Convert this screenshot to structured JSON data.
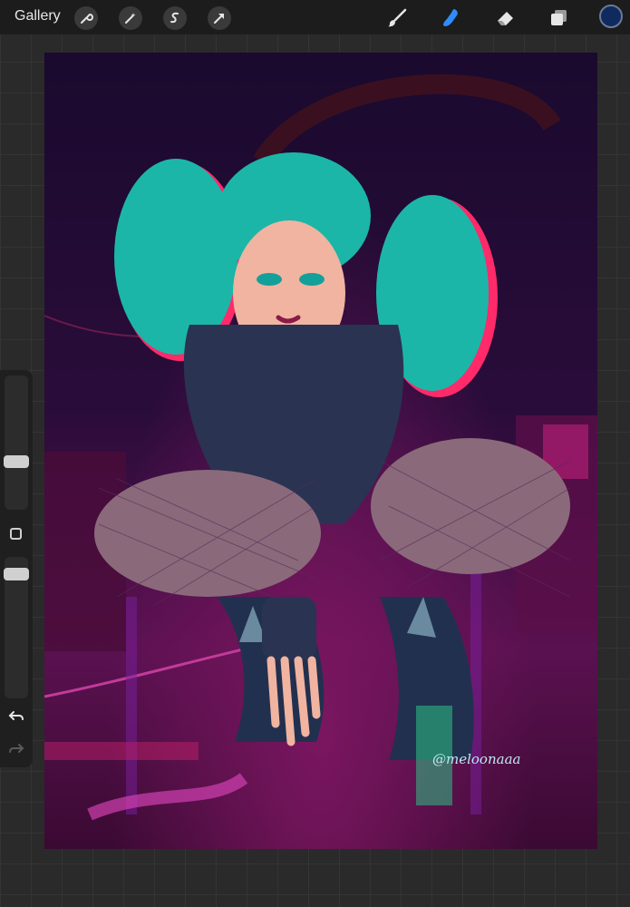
{
  "topbar": {
    "gallery_label": "Gallery",
    "left_tools": [
      "wrench-icon",
      "magic-wand-icon",
      "selection-icon",
      "transform-arrow-icon"
    ],
    "right_tools": [
      "brush-icon",
      "smudge-icon",
      "eraser-icon",
      "layers-icon"
    ],
    "active_tool": "smudge-icon",
    "accent_color": "#2f8cff",
    "current_color": "#0f2a5e"
  },
  "canvas": {
    "signature": "@meloonaaa"
  },
  "sidebar": {
    "brush_size_level": 0.34,
    "opacity_level": 0.72
  }
}
